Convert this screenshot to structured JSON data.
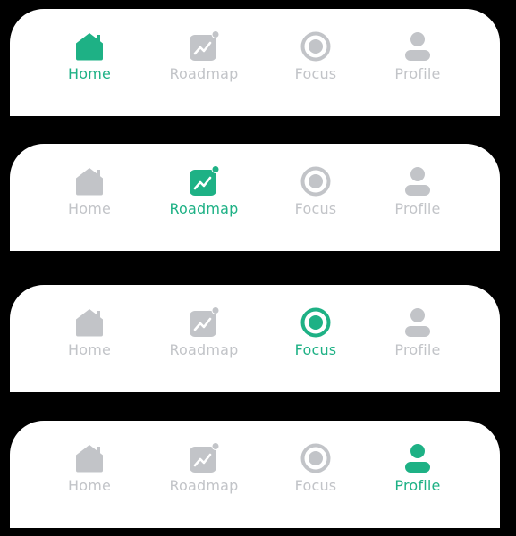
{
  "colors": {
    "active": "#1eb185",
    "inactive": "#c2c4c8",
    "bar_background": "#ffffff",
    "page_background": "#000000"
  },
  "states": [
    {
      "selected": "home",
      "tabs": [
        {
          "id": "home",
          "label": "Home",
          "icon": "home-icon"
        },
        {
          "id": "roadmap",
          "label": "Roadmap",
          "icon": "chart-icon"
        },
        {
          "id": "focus",
          "label": "Focus",
          "icon": "target-icon"
        },
        {
          "id": "profile",
          "label": "Profile",
          "icon": "user-icon"
        }
      ]
    },
    {
      "selected": "roadmap",
      "tabs": [
        {
          "id": "home",
          "label": "Home",
          "icon": "home-icon"
        },
        {
          "id": "roadmap",
          "label": "Roadmap",
          "icon": "chart-icon"
        },
        {
          "id": "focus",
          "label": "Focus",
          "icon": "target-icon"
        },
        {
          "id": "profile",
          "label": "Profile",
          "icon": "user-icon"
        }
      ]
    },
    {
      "selected": "focus",
      "tabs": [
        {
          "id": "home",
          "label": "Home",
          "icon": "home-icon"
        },
        {
          "id": "roadmap",
          "label": "Roadmap",
          "icon": "chart-icon"
        },
        {
          "id": "focus",
          "label": "Focus",
          "icon": "target-icon"
        },
        {
          "id": "profile",
          "label": "Profile",
          "icon": "user-icon"
        }
      ]
    },
    {
      "selected": "profile",
      "tabs": [
        {
          "id": "home",
          "label": "Home",
          "icon": "home-icon"
        },
        {
          "id": "roadmap",
          "label": "Roadmap",
          "icon": "chart-icon"
        },
        {
          "id": "focus",
          "label": "Focus",
          "icon": "target-icon"
        },
        {
          "id": "profile",
          "label": "Profile",
          "icon": "user-icon"
        }
      ]
    }
  ]
}
